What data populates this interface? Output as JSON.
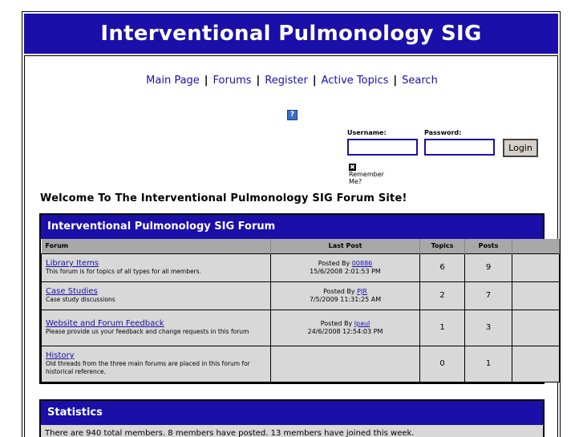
{
  "site_title": "Interventional Pulmonology SIG",
  "nav": {
    "main_page": "Main Page",
    "forums": "Forums",
    "register": "Register",
    "active_topics": "Active Topics",
    "search": "Search",
    "separator": "|"
  },
  "help_icon": "?",
  "login": {
    "username_label": "Username:",
    "password_label": "Password:",
    "username_value": "",
    "password_value": "",
    "login_button": "Login",
    "remember_label": "Remember Me?"
  },
  "welcome": "Welcome To The Interventional Pulmonology SIG Forum Site!",
  "forum_section": {
    "title": "Interventional Pulmonology SIG Forum",
    "columns": [
      "Forum",
      "Last Post",
      "Topics",
      "Posts"
    ],
    "rows": [
      {
        "name": "Library Items",
        "desc": "This forum is for topics of all types for all members.",
        "posted_by": "Posted By",
        "user": "00886",
        "date": "15/6/2008 2:01:53 PM",
        "topics": "6",
        "posts": "9"
      },
      {
        "name": "Case Studies",
        "desc": "Case study discussions",
        "posted_by": "Posted By",
        "user": "PJR",
        "date": "7/5/2009 11:31:25 AM",
        "topics": "2",
        "posts": "7"
      },
      {
        "name": "Website and Forum Feedback",
        "desc": "Please provide us your feedback and change requests in this forum",
        "posted_by": "Posted By",
        "user": "lpaul",
        "date": "24/6/2008 12:54:03 PM",
        "topics": "1",
        "posts": "3"
      },
      {
        "name": "History",
        "desc": "Old threads from the three main forums are placed in this forum for historical reference.",
        "posted_by": "",
        "user": "",
        "date": "",
        "topics": "0",
        "posts": "1"
      }
    ]
  },
  "statistics": {
    "title": "Statistics",
    "text": "There are 940 total members.  8 members have posted.  13 members have joined this week."
  },
  "colors": {
    "accent": "#1a0fa8",
    "header_gray": "#a8a8a8",
    "row_gray": "#d8d8d8"
  }
}
